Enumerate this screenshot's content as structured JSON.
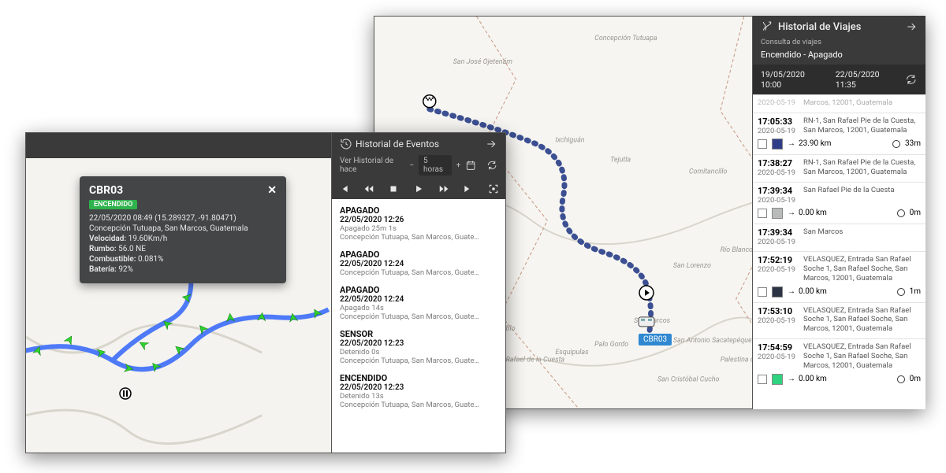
{
  "vehicle_id": "CBR03",
  "popup": {
    "title": "CBR03",
    "status_badge": "ENCENDIDO",
    "timestamp": "22/05/2020 08:49 (15.289327, -91.80471)",
    "location": "Concepción Tutuapa, San Marcos, Guatemala",
    "speed_label": "Velocidad:",
    "speed": "19.60Km/h",
    "heading_label": "Rumbo:",
    "heading": "56.0 NE",
    "fuel_label": "Combustible:",
    "fuel": "0.081%",
    "battery_label": "Batería:",
    "battery": "92%"
  },
  "events_panel": {
    "title": "Historial de Eventos",
    "hint_label": "Ver Historial de hace",
    "hours_value": "5 horas",
    "items": [
      {
        "name": "APAGADO",
        "time": "22/05/2020 12:26",
        "sub1": "Apagado 25m 1s",
        "sub2": "Concepción Tutuapa, San Marcos, Guate…"
      },
      {
        "name": "APAGADO",
        "time": "22/05/2020 12:24",
        "sub1": "",
        "sub2": "Concepción Tutuapa, San Marcos, Guate…"
      },
      {
        "name": "APAGADO",
        "time": "22/05/2020 12:24",
        "sub1": "Apagado 14s",
        "sub2": "Concepción Tutuapa, San Marcos, Guate…"
      },
      {
        "name": "SENSOR",
        "time": "22/05/2020 12:23",
        "sub1": "Detenido 0s",
        "sub2": "Concepción Tutuapa, San Marcos, Guate…"
      },
      {
        "name": "ENCENDIDO",
        "time": "22/05/2020 12:23",
        "sub1": "Detenido 13s",
        "sub2": "Concepción Tutuapa, San Marcos, Guate…"
      }
    ]
  },
  "trips_panel": {
    "title": "Historial de Viajes",
    "subtitle": "Consulta de viajes",
    "mode": "Encendido - Apagado",
    "from_date": "19/05/2020 10:00",
    "to_date": "22/05/2020 11:35",
    "cutoff_date": "2020-05-19",
    "cutoff_addr": "Marcos, 12001, Guatemala",
    "items": [
      {
        "time": "17:05:33",
        "date": "2020-05-19",
        "addr": "RN-1, San Rafael Pie de la Cuesta, San Marcos, 12001, Guatemala",
        "dist": "23.90 km",
        "dur": "33m",
        "swatch": "#2f3d88"
      },
      {
        "time": "17:38:27",
        "date": "2020-05-19",
        "addr": "RN-1, San Rafael Pie de la Cuesta, San Marcos, 12001, Guatemala"
      },
      {
        "time": "17:39:34",
        "date": "2020-05-19",
        "addr": "San Rafael Pie de la Cuesta",
        "dist": "0.00 km",
        "dur": "0m",
        "swatch": "#b9baba"
      },
      {
        "time": "17:39:34",
        "date": "2020-05-19",
        "addr": "San Marcos"
      },
      {
        "time": "17:52:19",
        "date": "2020-05-19",
        "addr": "VELASQUEZ, Entrada San Rafael Soche 1, San Rafael Soche, San Marcos, 12001, Guatemala",
        "dist": "0.00 km",
        "dur": "1m",
        "swatch": "#2b3345"
      },
      {
        "time": "17:53:10",
        "date": "2020-05-19",
        "addr": "VELASQUEZ, Entrada San Rafael Soche 1, San Rafael Soche, San Marcos, 12001, Guatemala"
      },
      {
        "time": "17:54:59",
        "date": "2020-05-19",
        "addr": "VELASQUEZ, Entrada San Rafael Soche 1, San Rafael Soche, San Marcos, 12001, Guatemala",
        "dist": "0.00 km",
        "dur": "0m",
        "swatch": "#2fd27f"
      }
    ]
  },
  "map_labels": {
    "tutuapa": "Concepción Tutuapa",
    "sanjose": "San José Ojetenám",
    "ixchiguan": "Ixchiguán",
    "tejutla": "Tejutla",
    "comitancillo": "Comitancillo",
    "sanlorenzo": "San Lorenzo",
    "rioblanco": "Río Blanco",
    "sanmarcos": "San Marcos",
    "esquipulas": "Esquipulas",
    "palogordo": "Palo Gordo",
    "sanpablo": "San Pablo",
    "sanrafael": "San Rafael de la Cuesta",
    "sanantonio": "San Antonio Sacatepéquez",
    "palestina": "Palestina de los Altos",
    "sancristobal": "San Cristóbal Cucho"
  }
}
